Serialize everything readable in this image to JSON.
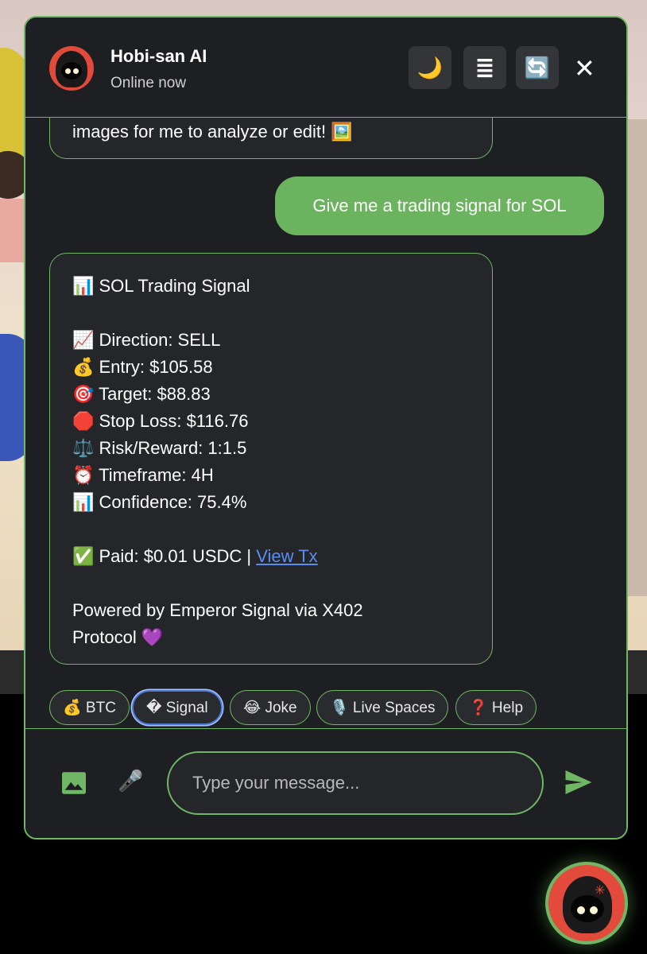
{
  "header": {
    "title": "Hobi-san AI",
    "status": "Online now",
    "buttons": [
      {
        "icon": "moon-icon",
        "glyph": "🌙"
      },
      {
        "icon": "menu-lines-icon",
        "glyph": "≣"
      },
      {
        "icon": "refresh-icon",
        "glyph": "🔄"
      }
    ],
    "close_glyph": "✕"
  },
  "messages": {
    "previous_bot_tail": "images for me to analyze or edit! 🖼️",
    "user_message": "Give me a trading signal for SOL",
    "signal": {
      "title": "📊 SOL Trading Signal",
      "direction": "📈 Direction: SELL",
      "entry": "💰 Entry: $105.58",
      "target": "🎯 Target: $88.83",
      "stop_loss": "🛑 Stop Loss: $116.76",
      "risk_reward": "⚖️ Risk/Reward: 1:1.5",
      "timeframe": "⏰ Timeframe: 4H",
      "confidence": "📊 Confidence: 75.4%",
      "paid": "✅ Paid: $0.01 USDC | ",
      "view_tx": "View Tx",
      "powered_1": "Powered by Emperor Signal via X402",
      "powered_2": "Protocol 💜"
    }
  },
  "quick_actions": [
    {
      "label": "💰 BTC"
    },
    {
      "label": "� Signal"
    },
    {
      "label": "😂 Joke"
    },
    {
      "label": "🎙️ Live Spaces"
    },
    {
      "label": "❓ Help"
    }
  ],
  "composer": {
    "placeholder": "Type your message...",
    "mic_glyph": "🎤"
  },
  "colors": {
    "accent": "#6fb764",
    "panel": "#1e1f22",
    "link": "#5b8cf0",
    "user_bubble": "#6cb35f"
  }
}
